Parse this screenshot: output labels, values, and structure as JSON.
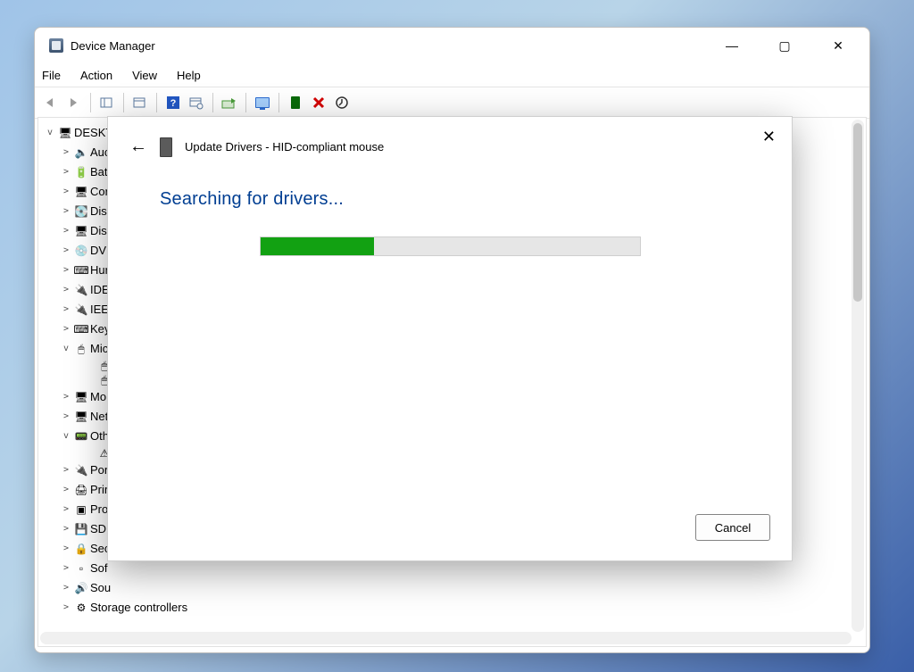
{
  "window": {
    "title": "Device Manager"
  },
  "menubar": [
    "File",
    "Action",
    "View",
    "Help"
  ],
  "tree": {
    "root": "DESKTC",
    "items": [
      {
        "exp": ">",
        "icon": "🔈",
        "label": "Auc",
        "indent": 2
      },
      {
        "exp": ">",
        "icon": "🔋",
        "label": "Batt",
        "indent": 2
      },
      {
        "exp": ">",
        "icon": "🖥",
        "label": "Cor",
        "indent": 2
      },
      {
        "exp": ">",
        "icon": "💽",
        "label": "Disl",
        "indent": 2
      },
      {
        "exp": ">",
        "icon": "🖥",
        "label": "Disp",
        "indent": 2
      },
      {
        "exp": ">",
        "icon": "💿",
        "label": "DVI",
        "indent": 2
      },
      {
        "exp": ">",
        "icon": "⌨",
        "label": "Hur",
        "indent": 2
      },
      {
        "exp": ">",
        "icon": "🔌",
        "label": "IDE",
        "indent": 2
      },
      {
        "exp": ">",
        "icon": "🔌",
        "label": "IEEE",
        "indent": 2
      },
      {
        "exp": ">",
        "icon": "⌨",
        "label": "Key",
        "indent": 2
      },
      {
        "exp": "v",
        "icon": "🖱",
        "label": "Mic",
        "indent": 2
      },
      {
        "exp": "",
        "icon": "🖱",
        "label": "",
        "indent": 3
      },
      {
        "exp": "",
        "icon": "🖱",
        "label": "",
        "indent": 3
      },
      {
        "exp": ">",
        "icon": "🖥",
        "label": "Mo",
        "indent": 2
      },
      {
        "exp": ">",
        "icon": "🖥",
        "label": "Net",
        "indent": 2
      },
      {
        "exp": "v",
        "icon": "📟",
        "label": "Oth",
        "indent": 2
      },
      {
        "exp": "",
        "icon": "⚠",
        "label": "",
        "indent": 3
      },
      {
        "exp": ">",
        "icon": "🔌",
        "label": "Por",
        "indent": 2
      },
      {
        "exp": ">",
        "icon": "🖨",
        "label": "Prir",
        "indent": 2
      },
      {
        "exp": ">",
        "icon": "▣",
        "label": "Pro",
        "indent": 2
      },
      {
        "exp": ">",
        "icon": "💾",
        "label": "SD i",
        "indent": 2
      },
      {
        "exp": ">",
        "icon": "🔒",
        "label": "Sec",
        "indent": 2
      },
      {
        "exp": ">",
        "icon": "▫",
        "label": "Sof",
        "indent": 2
      },
      {
        "exp": ">",
        "icon": "🔊",
        "label": "Sou",
        "indent": 2
      },
      {
        "exp": ">",
        "icon": "⚙",
        "label": "Storage controllers",
        "indent": 2
      }
    ]
  },
  "dialog": {
    "title": "Update Drivers - HID-compliant mouse",
    "heading": "Searching for drivers...",
    "progress_pct": 30,
    "cancel": "Cancel"
  }
}
